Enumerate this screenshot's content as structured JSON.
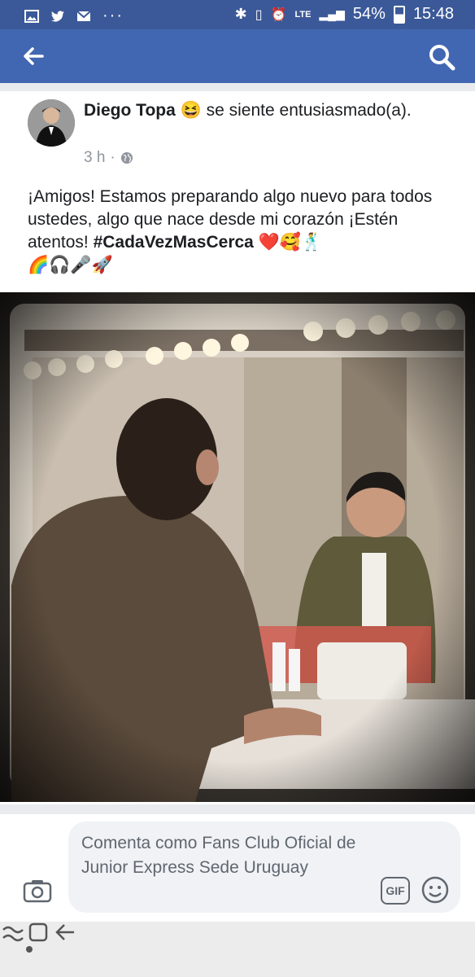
{
  "status_bar": {
    "network": "LTE",
    "battery": "54%",
    "time": "15:48"
  },
  "post": {
    "author": "Diego Topa",
    "feeling": "se siente entusiasmado(a).",
    "feeling_emoji": "😆",
    "time": "3 h",
    "text_main": "¡Amigos! Estamos preparando algo nuevo para todos ustedes, algo que nace desde mi corazón ¡Estén atentos! ",
    "hashtag": "#CadaVezMasCerca",
    "emojis_inline": " ❤️🥰🕺",
    "emojis_line2": "🌈🎧🎤🚀"
  },
  "comment": {
    "placeholder": "Comenta como Fans Club Oficial de Junior Express Sede Uruguay",
    "gif_label": "GIF"
  },
  "colors": {
    "statusbar": "#3b5998",
    "navbar": "#4267b2"
  }
}
